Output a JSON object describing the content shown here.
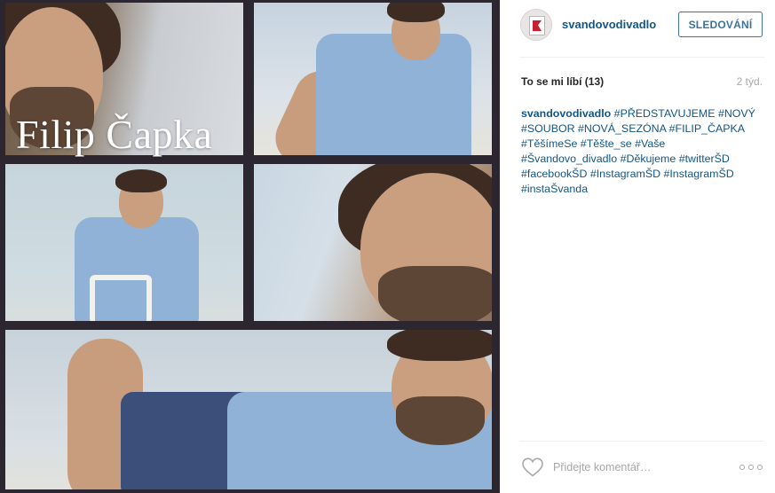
{
  "post": {
    "photo_caption": "Filip Čapka",
    "author": {
      "username": "svandovodivadlo",
      "avatar_icon": "theatre-logo-icon"
    },
    "follow_label": "SLEDOVÁNÍ",
    "likes_label": "To se mi líbí (13)",
    "time_ago": "2 týd.",
    "caption": {
      "author": "svandovodivadlo",
      "text": "#PŘEDSTAVUJEME #NOVÝ #SOUBOR #NOVÁ_SEZÓNA #FILIP_ČAPKA #TěšímeSe #Těšte_se #Vaše #Švandovo_divadlo #Děkujeme #twitterŠD #facebookŠD #InstagramŠD #InstagramŠD #instaŠvanda"
    },
    "comment_placeholder": "Přidejte komentář…",
    "icons": {
      "like": "heart-icon",
      "more": "more-options-icon"
    },
    "colors": {
      "link": "#125688",
      "button": "#3f729b",
      "muted": "#a5a7aa"
    }
  }
}
